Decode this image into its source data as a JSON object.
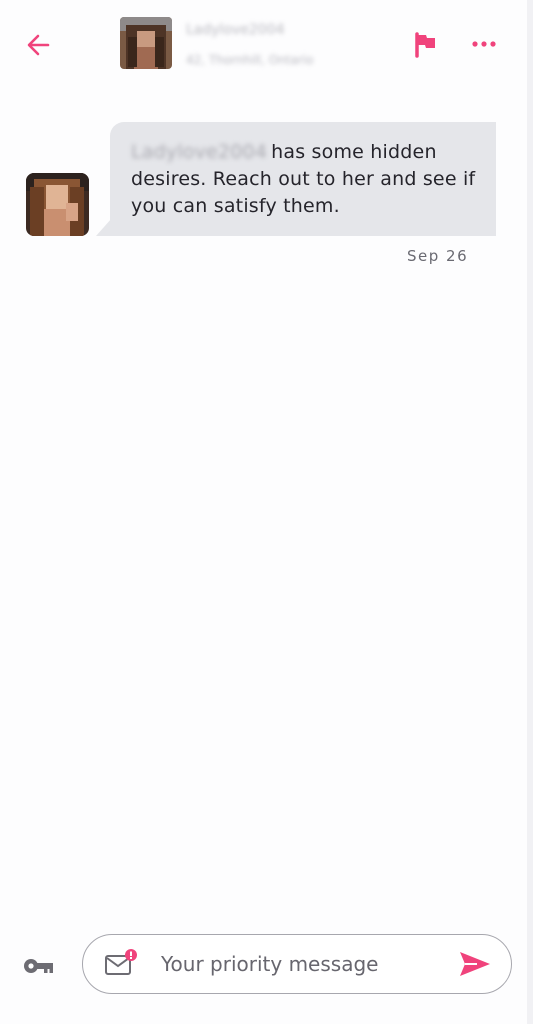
{
  "colors": {
    "accent": "#f0437c",
    "bubble": "#e5e6ea",
    "text": "#25242b",
    "muted": "#6a6a72"
  },
  "header": {
    "back_icon": "arrow-left-icon",
    "name": "Ladylove2004",
    "location": "42, Thornhill, Ontario",
    "flag_icon": "flag-icon",
    "more_icon": "more-dots-icon"
  },
  "message": {
    "sender_name": "Ladylove2004",
    "text": "has some hidden desires. Reach out to her and see if you can satisfy them.",
    "date": "Sep 26"
  },
  "composer": {
    "key_icon": "key-icon",
    "mail_icon": "mail-notification-icon",
    "placeholder": "Your priority message",
    "send_icon": "send-icon"
  }
}
